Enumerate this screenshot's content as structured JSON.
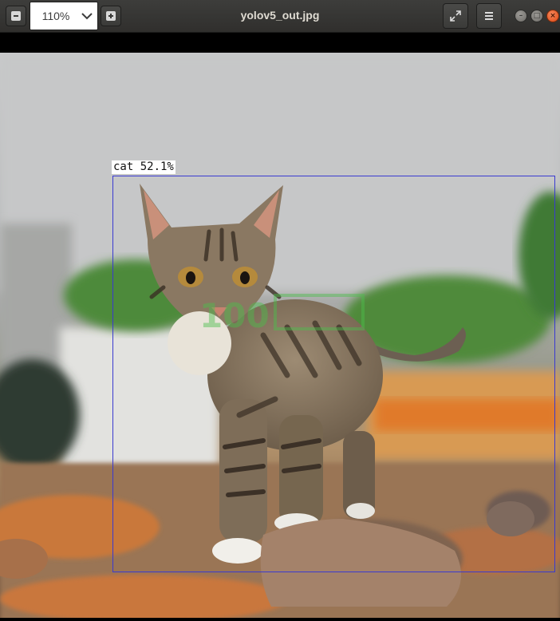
{
  "toolbar": {
    "zoom_out_icon": "minus-icon",
    "zoom_value": "110%",
    "zoom_in_icon": "plus-icon",
    "fullscreen_icon": "fullscreen-icon",
    "menu_icon": "hamburger-menu-icon"
  },
  "window": {
    "title": "yolov5_out.jpg",
    "controls": [
      "minimize-icon",
      "maximize-icon",
      "close-icon"
    ]
  },
  "image": {
    "detection": {
      "label": "cat 52.1%",
      "box_color": "#3a3ad0"
    }
  },
  "colors": {
    "titlebar": "#353533",
    "close_button": "#e95420",
    "watermark_green": "#4bbf4b"
  }
}
